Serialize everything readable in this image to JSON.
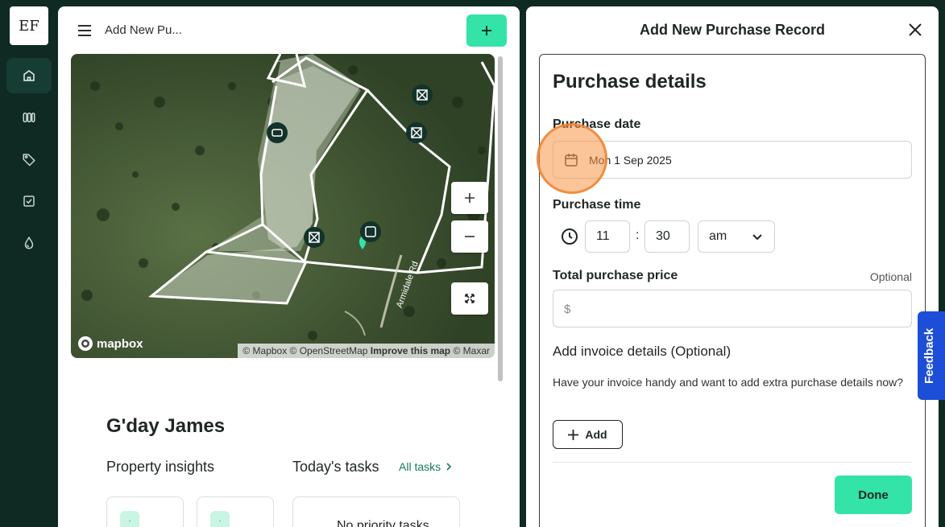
{
  "brand": {
    "logo_text": "EF"
  },
  "rail": {
    "items": [
      {
        "name": "home-icon",
        "active": true
      },
      {
        "name": "paddocks-icon",
        "active": false
      },
      {
        "name": "tag-icon",
        "active": false
      },
      {
        "name": "tasks-icon",
        "active": false
      },
      {
        "name": "water-icon",
        "active": false
      }
    ]
  },
  "middle": {
    "title": "Add New Pu...",
    "map": {
      "brand": "mapbox",
      "attribution_a": "© Mapbox © OpenStreetMap ",
      "attribution_improve": "Improve this map",
      "attribution_b": " © Maxar",
      "road_label": "Armidale Rd",
      "zoom_in": "+",
      "zoom_out": "−"
    },
    "greeting": "G'day James",
    "insights_title": "Property insights",
    "tasks_title": "Today's tasks",
    "all_tasks_link": "All tasks",
    "no_tasks_text": "No priority tasks"
  },
  "panel": {
    "title": "Add New Purchase Record",
    "section_title": "Purchase details",
    "date_label": "Purchase date",
    "date_value": "Mon 1 Sep 2025",
    "time_label": "Purchase time",
    "hour": "11",
    "minute": "30",
    "ampm": "am",
    "price_label": "Total purchase price",
    "price_optional": "Optional",
    "price_prefix": "$",
    "invoice_title": "Add invoice details (Optional)",
    "invoice_desc": "Have your invoice handy and want to add extra purchase details now?",
    "add_label": "Add",
    "done_label": "Done"
  },
  "feedback_label": "Feedback",
  "colors": {
    "accent": "#33e3a8",
    "sidebar": "#0e2a23",
    "feedback": "#1d4ed8",
    "link": "#187a5b"
  }
}
